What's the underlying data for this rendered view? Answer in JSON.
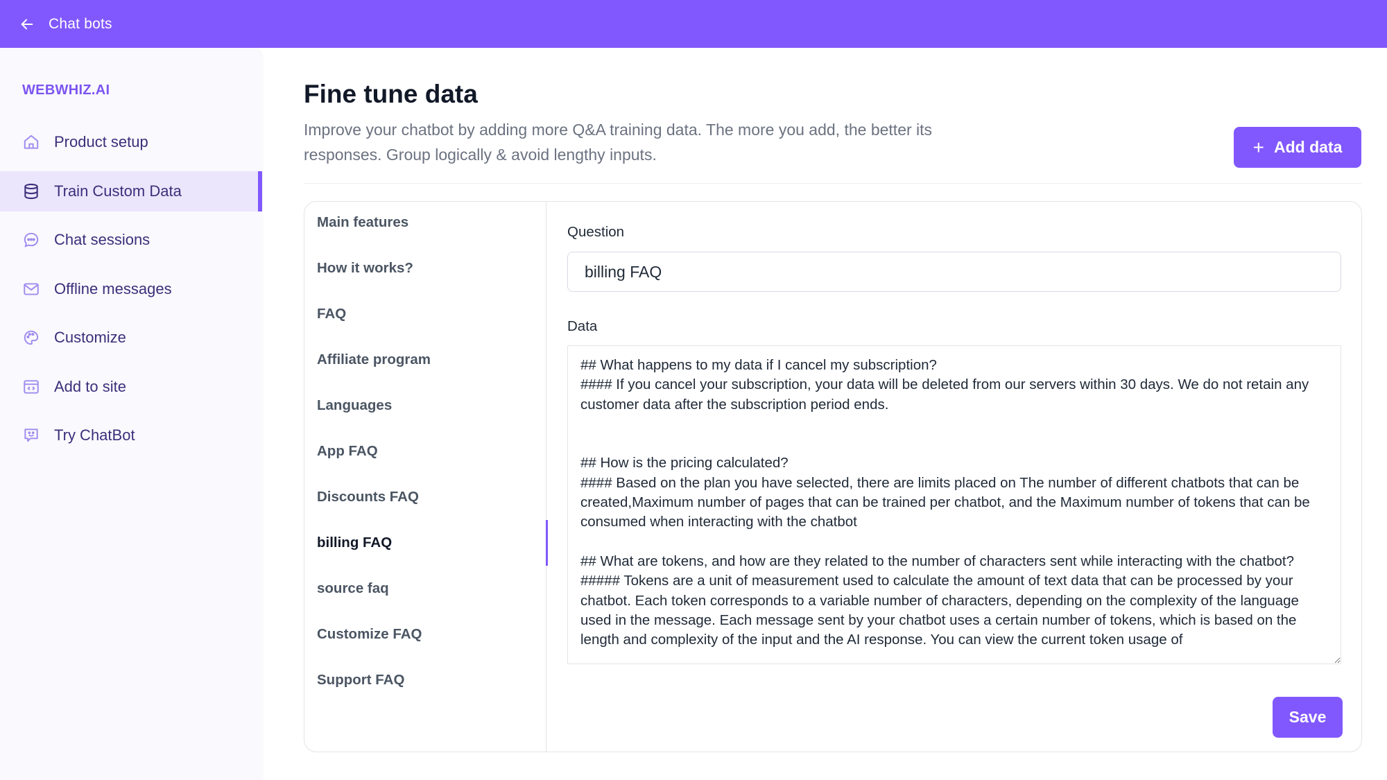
{
  "topbar": {
    "back_label": "Chat bots",
    "back_icon": "arrow-left-icon",
    "color": "#8158fd"
  },
  "sidebar": {
    "brand": "WEBWHIZ.AI",
    "items": [
      {
        "label": "Product setup",
        "icon": "home-icon",
        "active": false
      },
      {
        "label": "Train Custom Data",
        "icon": "database-icon",
        "active": true
      },
      {
        "label": "Chat sessions",
        "icon": "chat-bubble-icon",
        "active": false
      },
      {
        "label": "Offline messages",
        "icon": "envelope-icon",
        "active": false
      },
      {
        "label": "Customize",
        "icon": "palette-icon",
        "active": false
      },
      {
        "label": "Add to site",
        "icon": "code-window-icon",
        "active": false
      },
      {
        "label": "Try ChatBot",
        "icon": "bot-face-icon",
        "active": false
      }
    ]
  },
  "header": {
    "title": "Fine tune data",
    "description": "Improve your chatbot by adding more Q&A training data. The more you add, the better its responses. Group logically & avoid lengthy inputs.",
    "add_button_label": "Add data",
    "add_button_icon": "plus-icon"
  },
  "topics": {
    "items": [
      "Main features",
      "How it works?",
      "FAQ",
      "Affiliate program",
      "Languages",
      "App FAQ",
      "Discounts FAQ",
      "billing FAQ",
      "source faq",
      "Customize FAQ",
      "Support FAQ"
    ],
    "selected_index": 7
  },
  "form": {
    "question_label": "Question",
    "question_value": "billing FAQ",
    "data_label": "Data",
    "data_value": "## What happens to my data if I cancel my subscription?\n#### If you cancel your subscription, your data will be deleted from our servers within 30 days. We do not retain any customer data after the subscription period ends.\n\n\n## How is the pricing calculated?\n#### Based on the plan you have selected, there are limits placed on The number of different chatbots that can be created,Maximum number of pages that can be trained per chatbot, and the Maximum number of tokens that can be consumed when interacting with the chatbot\n\n## What are tokens, and how are they related to the number of characters sent while interacting with the chatbot?\n##### Tokens are a unit of measurement used to calculate the amount of text data that can be processed by your chatbot. Each token corresponds to a variable number of characters, depending on the complexity of the language used in the message. Each message sent by your chatbot uses a certain number of tokens, which is based on the length and complexity of the input and the AI response. You can view the current token usage of",
    "save_label": "Save"
  }
}
